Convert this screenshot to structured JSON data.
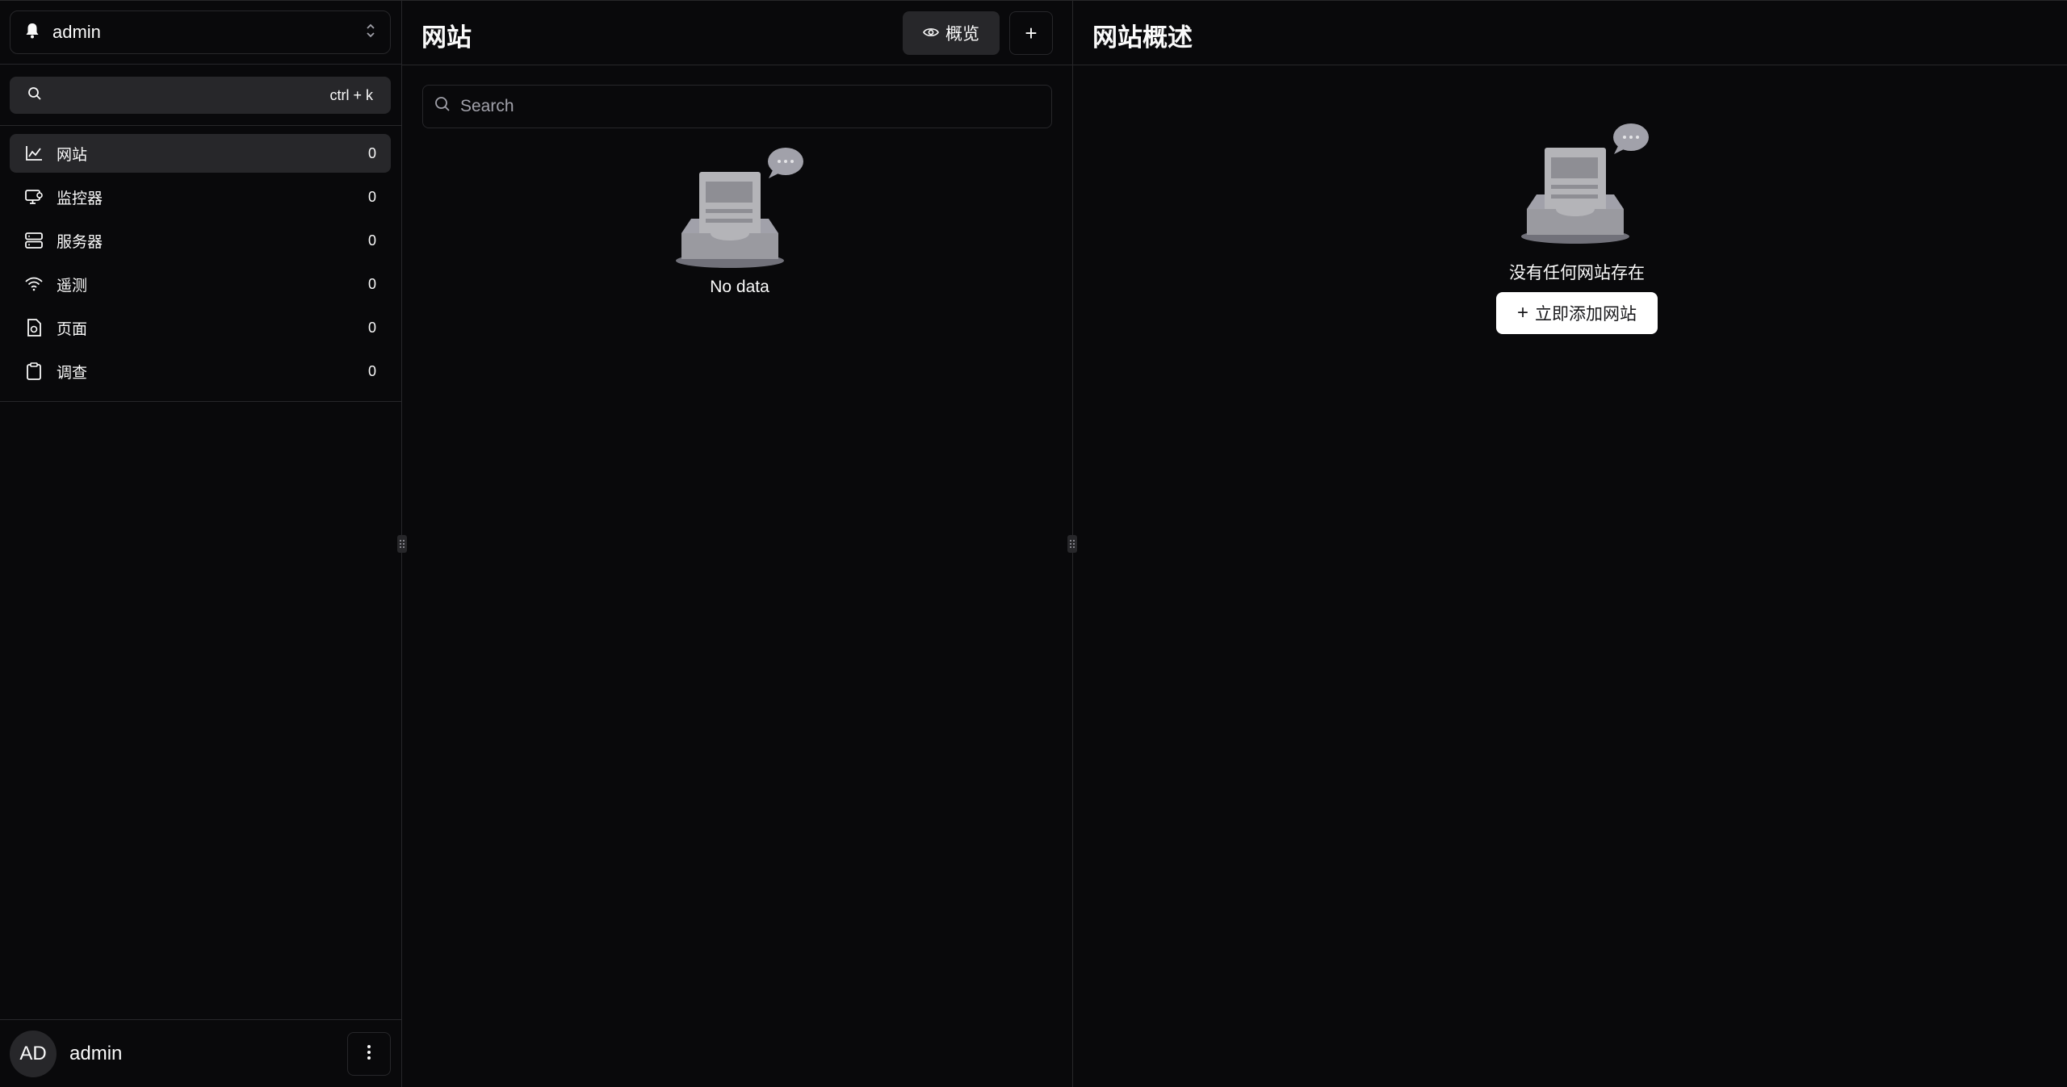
{
  "workspace": {
    "name": "admin",
    "icon": "bell-icon"
  },
  "search": {
    "shortcut": "ctrl + k"
  },
  "sidebar": {
    "items": [
      {
        "label": "网站",
        "count": "0",
        "icon": "chart-icon",
        "active": true
      },
      {
        "label": "监控器",
        "count": "0",
        "icon": "monitor-icon",
        "active": false
      },
      {
        "label": "服务器",
        "count": "0",
        "icon": "server-icon",
        "active": false
      },
      {
        "label": "遥测",
        "count": "0",
        "icon": "wifi-icon",
        "active": false
      },
      {
        "label": "页面",
        "count": "0",
        "icon": "page-icon",
        "active": false
      },
      {
        "label": "调查",
        "count": "0",
        "icon": "clipboard-icon",
        "active": false
      }
    ]
  },
  "user": {
    "initials": "AD",
    "name": "admin"
  },
  "websites": {
    "title": "网站",
    "overview_label": "概览",
    "add_label": "+",
    "search_placeholder": "Search",
    "empty_text": "No data"
  },
  "overview": {
    "title": "网站概述",
    "empty_text": "没有任何网站存在",
    "add_button_label": "立即添加网站"
  },
  "colors": {
    "background": "#09090b",
    "surface": "#27272a",
    "border": "#27272a",
    "text": "#fafafa",
    "muted": "#a1a1aa"
  }
}
